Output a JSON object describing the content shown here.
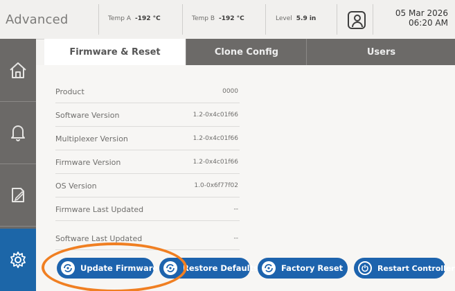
{
  "header": {
    "title": "Advanced",
    "temp_a": {
      "label": "Temp A",
      "value": "-192 °C"
    },
    "temp_b": {
      "label": "Temp B",
      "value": "-192 °C"
    },
    "level": {
      "label": "Level",
      "value": "5.9 in"
    },
    "date": "05 Mar 2026",
    "time": "06:20 AM"
  },
  "sidebar": {
    "items": [
      {
        "icon": "home-icon"
      },
      {
        "icon": "bell-icon"
      },
      {
        "icon": "notes-icon"
      },
      {
        "icon": "gear-icon",
        "active": true
      }
    ]
  },
  "tabs": [
    {
      "label": "Firmware & Reset",
      "active": true
    },
    {
      "label": "Clone Config",
      "active": false
    },
    {
      "label": "Users",
      "active": false
    }
  ],
  "info_rows": [
    {
      "label": "Product",
      "value": "0000"
    },
    {
      "label": "Software Version",
      "value": "1.2-0x4c01f66"
    },
    {
      "label": "Multiplexer Version",
      "value": "1.2-0x4c01f66"
    },
    {
      "label": "Firmware Version",
      "value": "1.2-0x4c01f66"
    },
    {
      "label": "OS Version",
      "value": "1.0-0x6f77f02"
    },
    {
      "label": "Firmware Last Updated",
      "value": "--"
    },
    {
      "label": "Software Last Updated",
      "value": "--"
    }
  ],
  "buttons": {
    "update_firmware": "Update Firmware",
    "restore_defaults": "Restore Defaults",
    "factory_reset": "Factory Reset",
    "restart_controller": "Restart Controller"
  },
  "colors": {
    "accent": "#1d63ad",
    "sidebar_bg": "#6b6967",
    "highlight": "#f07f22"
  }
}
